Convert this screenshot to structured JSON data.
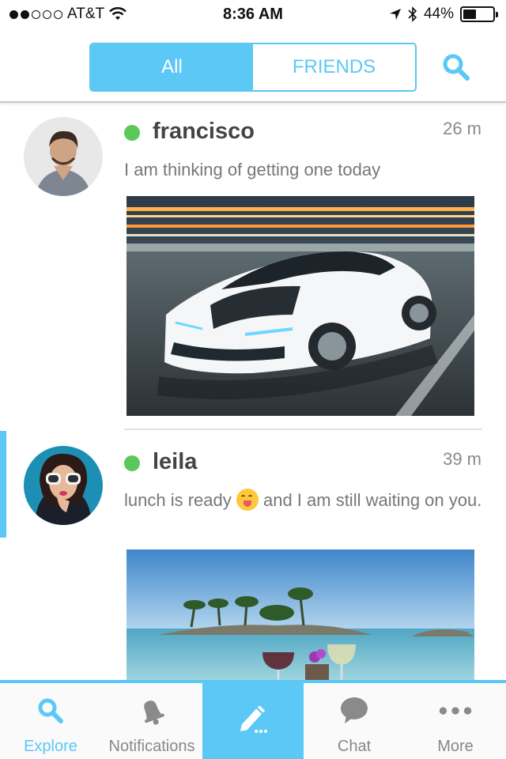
{
  "status_bar": {
    "carrier": "AT&T",
    "time": "8:36 AM",
    "battery": "44%",
    "battery_level": 0.44
  },
  "header": {
    "tabs": [
      {
        "label": "All",
        "active": true
      },
      {
        "label": "FRIENDS",
        "active": false
      }
    ],
    "search_icon": "search-icon"
  },
  "feed": {
    "posts": [
      {
        "name": "francisco",
        "time": "26 m",
        "online": true,
        "message": "I am thinking of getting one today",
        "photo": "car-photo"
      },
      {
        "name": "leila",
        "time": "39 m",
        "online": true,
        "message_before_emoji": "lunch is ready ",
        "message_after_emoji": " and I am still waiting on you.",
        "emoji": "yum-face-emoji",
        "photo": "beach-lunch-photo"
      }
    ]
  },
  "tabbar": {
    "items": [
      {
        "label": "Explore",
        "icon": "search-icon",
        "selected": true
      },
      {
        "label": "Notifications",
        "icon": "bell-icon",
        "selected": false
      },
      {
        "label": "",
        "icon": "compose-icon",
        "selected": false
      },
      {
        "label": "Chat",
        "icon": "chat-bubble-icon",
        "selected": false
      },
      {
        "label": "More",
        "icon": "more-dots-icon",
        "selected": false
      }
    ]
  },
  "colors": {
    "accent": "#5bc8f5",
    "online": "#5cc85c"
  }
}
